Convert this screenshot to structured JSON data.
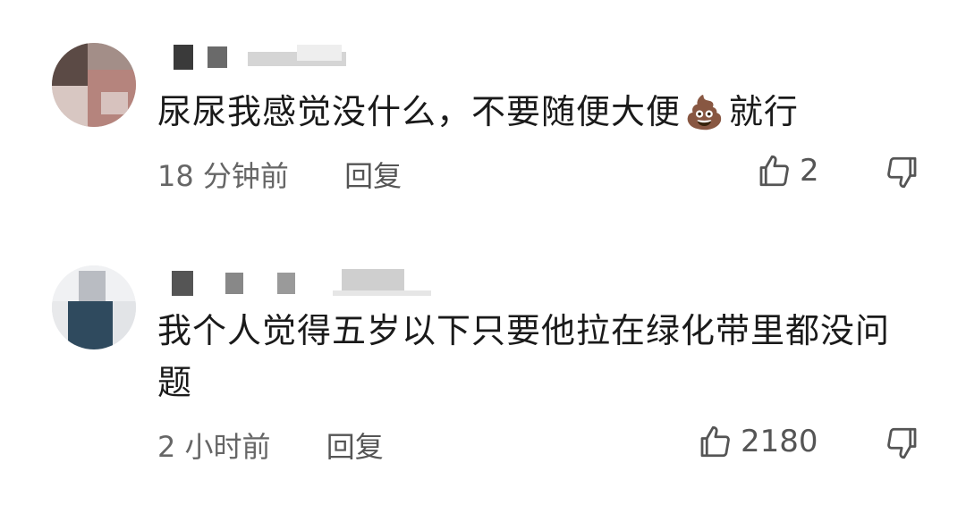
{
  "comments": [
    {
      "content_before_emoji": "尿尿我感觉没什么，不要随便大便",
      "emoji": "💩",
      "content_after_emoji": "就行",
      "time": "18 分钟前",
      "reply_label": "回复",
      "like_count": "2"
    },
    {
      "content": "我个人觉得五岁以下只要他拉在绿化带里都没问题",
      "time": "2 小时前",
      "reply_label": "回复",
      "like_count": "2180"
    }
  ],
  "icons": {
    "like": "thumbs-up-outline",
    "dislike": "thumbs-down-outline",
    "emoji": "pile-of-poo"
  },
  "colors": {
    "text_primary": "#1a1a1a",
    "text_secondary": "#666666",
    "icon": "#555555",
    "background": "#ffffff"
  }
}
